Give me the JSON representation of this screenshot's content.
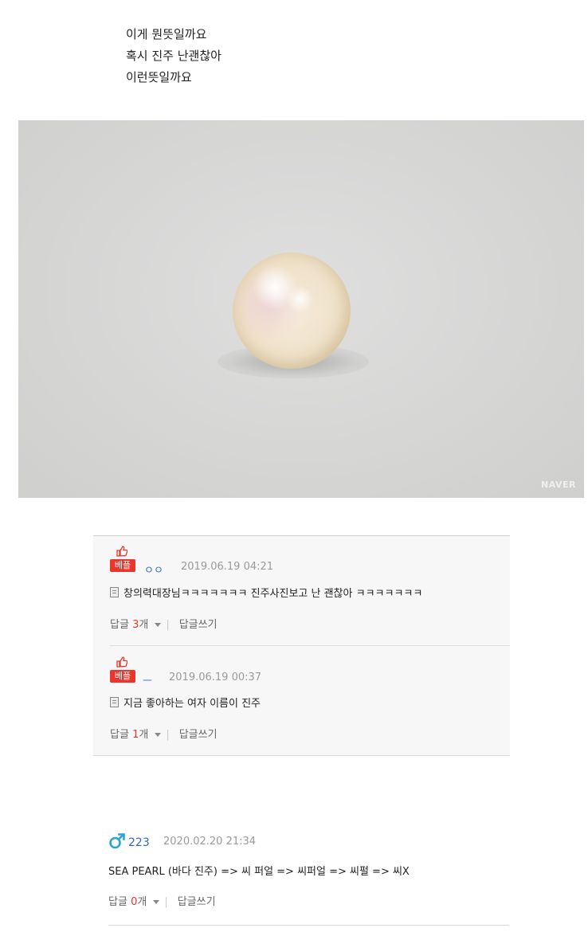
{
  "post": {
    "lines": [
      "이게 뭔뜻일까요",
      "혹시 진주 난괜찮아",
      "이런뜻일까요"
    ]
  },
  "photo": {
    "watermark": "NAVER",
    "alt": "pearl-photo"
  },
  "best_comments": [
    {
      "badge": "베플",
      "nick": "ㅇㅇ",
      "date": "2019.06.19 04:21",
      "text": "창의력대장님ㅋㅋㅋㅋㅋㅋㅋ 진주사진보고 난 괜찮아 ㅋㅋㅋㅋㅋㅋㅋ",
      "reply_label": "답글",
      "reply_count": "3",
      "reply_unit": "개",
      "write_reply": "답글쓰기"
    },
    {
      "badge": "베플",
      "nick": "ㅡ",
      "date": "2019.06.19 00:37",
      "text": "지금 좋아하는 여자 이름이 진주",
      "reply_label": "답글",
      "reply_count": "1",
      "reply_unit": "개",
      "write_reply": "답글쓰기"
    }
  ],
  "comment": {
    "gender_icon": "male-icon",
    "nick": "223",
    "date": "2020.02.20 21:34",
    "text": "SEA PEARL (바다 진주) => 씨 퍼얼 => 씨퍼얼 => 씨펄 => 씨X",
    "reply_label": "답글",
    "reply_count": "0",
    "reply_unit": "개",
    "write_reply": "답글쓰기"
  },
  "colors": {
    "best_badge": "#e8362c",
    "nick": "#3366cc",
    "male_icon": "#2aa3d8",
    "date": "#999999"
  }
}
